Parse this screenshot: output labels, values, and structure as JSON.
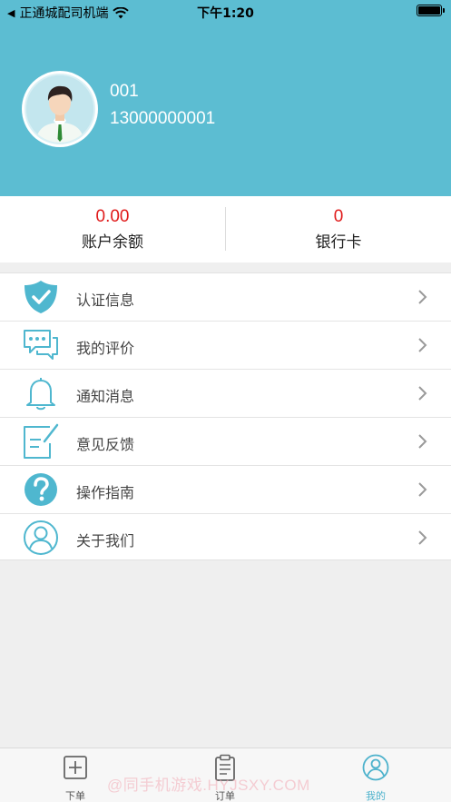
{
  "status_bar": {
    "back_glyph": "◀",
    "carrier": "正通城配司机端",
    "time": "下午1:20"
  },
  "profile": {
    "name": "001",
    "phone": "13000000001"
  },
  "stats": [
    {
      "value": "0.00",
      "label": "账户余额"
    },
    {
      "value": "0",
      "label": "银行卡"
    }
  ],
  "menu": [
    {
      "label": "认证信息",
      "icon": "shield-check-icon"
    },
    {
      "label": "我的评价",
      "icon": "chat-bubbles-icon"
    },
    {
      "label": "通知消息",
      "icon": "bell-icon"
    },
    {
      "label": "意见反馈",
      "icon": "feedback-edit-icon"
    },
    {
      "label": "操作指南",
      "icon": "question-icon"
    },
    {
      "label": "关于我们",
      "icon": "user-circle-icon"
    }
  ],
  "tabs": [
    {
      "label": "下单",
      "icon": "plus-square-icon",
      "active": false
    },
    {
      "label": "订单",
      "icon": "clipboard-icon",
      "active": false
    },
    {
      "label": "我的",
      "icon": "user-circle-icon",
      "active": true
    }
  ],
  "watermark": "@同手机游戏.HYJSXY.COM",
  "colors": {
    "header_bg": "#5cbdd2",
    "accent": "#4db2cc",
    "value_red": "#e01b1b"
  }
}
